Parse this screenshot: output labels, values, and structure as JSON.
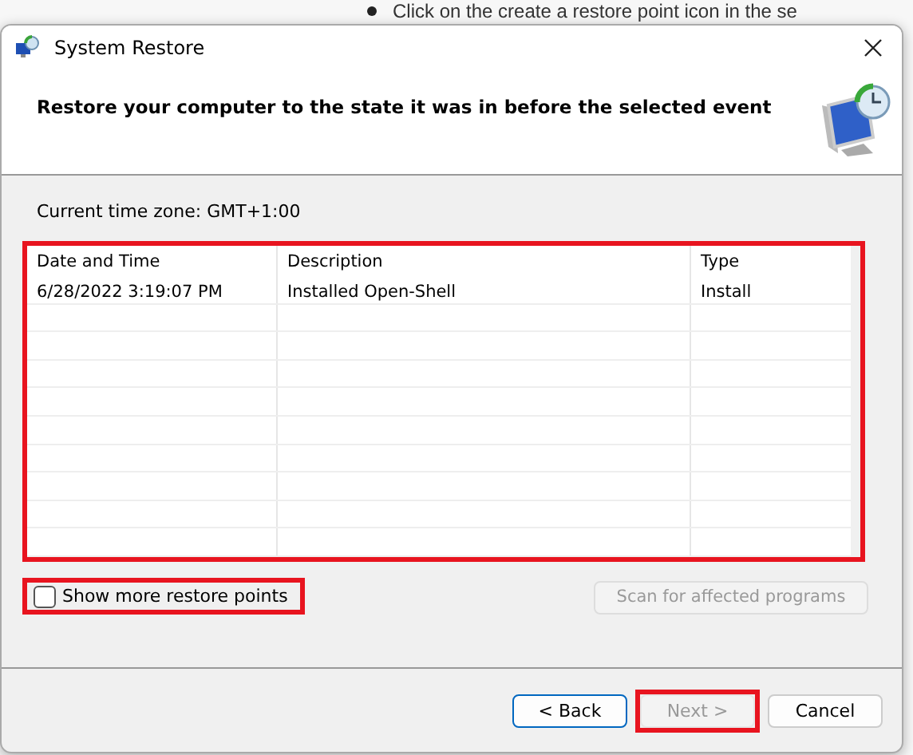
{
  "background_page": {
    "bullet_text": "Click on the create a restore point icon in the se"
  },
  "window": {
    "title": "System Restore",
    "heading": "Restore your computer to the state it was in before the selected event"
  },
  "time_zone": "Current time zone: GMT+1:00",
  "table": {
    "highlighted": true,
    "columns": [
      "Date and Time",
      "Description",
      "Type"
    ],
    "rows": [
      [
        "6/28/2022 3:19:07 PM",
        "Installed Open-Shell",
        "Install"
      ]
    ]
  },
  "show_more": {
    "label": "Show more restore points",
    "checked": false,
    "highlighted": true
  },
  "scan_button": {
    "label": "Scan for affected programs",
    "disabled": true
  },
  "buttons": [
    {
      "label": "< Back",
      "disabled": false,
      "focused": true,
      "highlighted": false
    },
    {
      "label": "Next >",
      "disabled": true,
      "focused": false,
      "highlighted": true
    },
    {
      "label": "Cancel",
      "disabled": false,
      "focused": false,
      "highlighted": false
    }
  ]
}
